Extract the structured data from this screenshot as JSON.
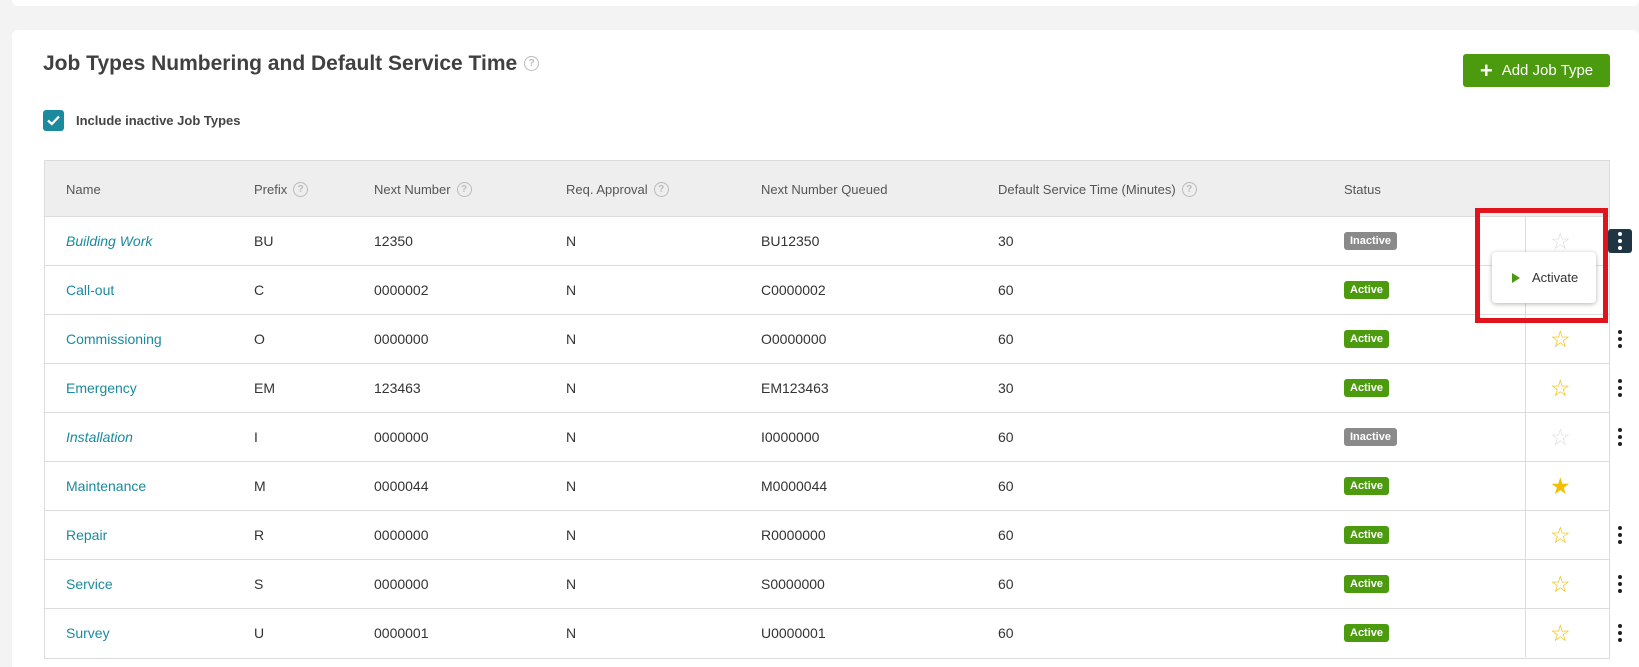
{
  "page": {
    "title": "Job Types Numbering and Default Service Time",
    "add_button_label": "Add Job Type",
    "include_inactive_label": "Include inactive Job Types",
    "include_inactive_checked": true
  },
  "table": {
    "columns": [
      "Name",
      "Prefix",
      "Next Number",
      "Req. Approval",
      "Next Number Queued",
      "Default Service Time (Minutes)",
      "Status"
    ],
    "rows": [
      {
        "name": "Building Work",
        "prefix": "BU",
        "next_number": "12350",
        "req_approval": "N",
        "next_queued": "BU12350",
        "service_time": "30",
        "status": "Inactive",
        "favorite": "none",
        "menu": true
      },
      {
        "name": "Call-out",
        "prefix": "C",
        "next_number": "0000002",
        "req_approval": "N",
        "next_queued": "C0000002",
        "service_time": "60",
        "status": "Active",
        "favorite": "hidden",
        "menu": false
      },
      {
        "name": "Commissioning",
        "prefix": "O",
        "next_number": "0000000",
        "req_approval": "N",
        "next_queued": "O0000000",
        "service_time": "60",
        "status": "Active",
        "favorite": "outline",
        "menu": true
      },
      {
        "name": "Emergency",
        "prefix": "EM",
        "next_number": "123463",
        "req_approval": "N",
        "next_queued": "EM123463",
        "service_time": "30",
        "status": "Active",
        "favorite": "outline",
        "menu": true
      },
      {
        "name": "Installation",
        "prefix": "I",
        "next_number": "0000000",
        "req_approval": "N",
        "next_queued": "I0000000",
        "service_time": "60",
        "status": "Inactive",
        "favorite": "none",
        "menu": true
      },
      {
        "name": "Maintenance",
        "prefix": "M",
        "next_number": "0000044",
        "req_approval": "N",
        "next_queued": "M0000044",
        "service_time": "60",
        "status": "Active",
        "favorite": "filled",
        "menu": false
      },
      {
        "name": "Repair",
        "prefix": "R",
        "next_number": "0000000",
        "req_approval": "N",
        "next_queued": "R0000000",
        "service_time": "60",
        "status": "Active",
        "favorite": "outline",
        "menu": true
      },
      {
        "name": "Service",
        "prefix": "S",
        "next_number": "0000000",
        "req_approval": "N",
        "next_queued": "S0000000",
        "service_time": "60",
        "status": "Active",
        "favorite": "outline",
        "menu": true
      },
      {
        "name": "Survey",
        "prefix": "U",
        "next_number": "0000001",
        "req_approval": "N",
        "next_queued": "U0000001",
        "service_time": "60",
        "status": "Active",
        "favorite": "outline",
        "menu": true
      }
    ]
  },
  "context_menu": {
    "item_label": "Activate"
  },
  "colors": {
    "accent_green": "#4c9a0e",
    "link_teal": "#1b8a9e",
    "inactive_grey": "#8a8a8a",
    "star_yellow": "#f2c000",
    "highlight_red": "#e0141c"
  }
}
